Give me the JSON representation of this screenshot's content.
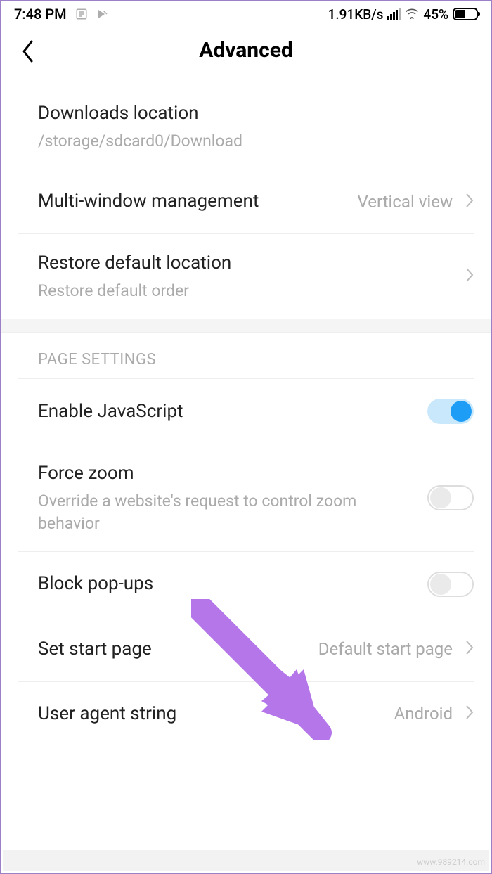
{
  "status_bar": {
    "time": "7:48 PM",
    "data_rate": "1.91KB/s",
    "battery_percent": "45%"
  },
  "header": {
    "title": "Advanced"
  },
  "group1": {
    "downloads": {
      "title": "Downloads location",
      "subtitle": "/storage/sdcard0/Download"
    },
    "multiwindow": {
      "title": "Multi-window management",
      "value": "Vertical view"
    },
    "restore": {
      "title": "Restore default location",
      "subtitle": "Restore default order"
    }
  },
  "group2": {
    "header": "PAGE SETTINGS",
    "javascript": {
      "title": "Enable JavaScript",
      "enabled": true
    },
    "force_zoom": {
      "title": "Force zoom",
      "subtitle": "Override a website's request to control zoom behavior",
      "enabled": false
    },
    "block_popups": {
      "title": "Block pop-ups",
      "enabled": false
    },
    "start_page": {
      "title": "Set start page",
      "value": "Default start page"
    },
    "user_agent": {
      "title": "User agent string",
      "value": "Android"
    }
  },
  "watermark": "www.989214.com"
}
